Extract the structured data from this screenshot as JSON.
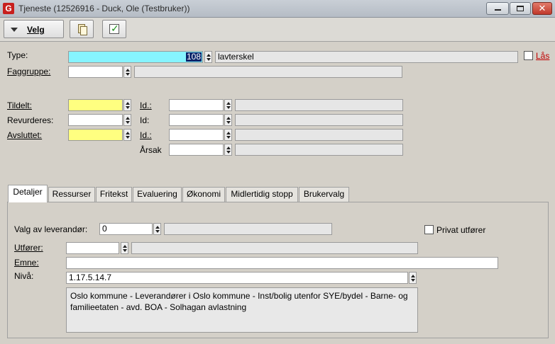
{
  "window": {
    "title": "Tjeneste (12526916 - Duck, Ole (Testbruker))",
    "app_icon": "G"
  },
  "toolbar": {
    "velg_label": "Velg"
  },
  "form": {
    "type_label": "Type:",
    "type_value": "108",
    "type_desc": "lavterskel",
    "las_label": "Lås",
    "faggruppe_label": "Faggruppe:",
    "tildelt_label": "Tildelt:",
    "revurderes_label": "Revurderes:",
    "avsluttet_label": "Avsluttet:",
    "id1_label": "Id.:",
    "id2_label": "Id:",
    "id3_label": "Id.:",
    "arsak_label": "Årsak"
  },
  "tabs": [
    {
      "label": "Detaljer",
      "active": true
    },
    {
      "label": "Ressurser"
    },
    {
      "label": "Fritekst"
    },
    {
      "label": "Evaluering"
    },
    {
      "label": "Økonomi"
    },
    {
      "label": "Midlertidig stopp"
    },
    {
      "label": "Brukervalg"
    }
  ],
  "details": {
    "leverandor_label": "Valg av leverandør:",
    "leverandor_value": "0",
    "privat_label": "Privat utfører",
    "utforer_label": "Utfører:",
    "emne_label": "Emne:",
    "niva_label": "Nivå:",
    "niva_value": "1.17.5.14.7",
    "niva_desc": "Oslo kommune - Leverandører i Oslo kommune - Inst/bolig utenfor SYE/bydel - Barne- og familieetaten - avd. BOA - Solhagan avlastning"
  }
}
